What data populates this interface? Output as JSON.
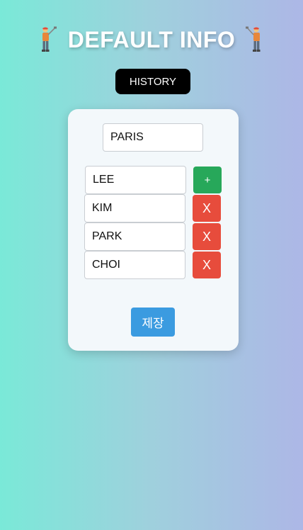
{
  "header": {
    "title": "DEFAULT INFO",
    "left_icon": "golfer-icon",
    "right_icon": "golfer-icon"
  },
  "history_button": {
    "label": "HISTORY"
  },
  "form": {
    "city": {
      "value": "PARIS"
    },
    "players": [
      {
        "value": "LEE",
        "action": "+"
      },
      {
        "value": "KIM",
        "action": "X"
      },
      {
        "value": "PARK",
        "action": "X"
      },
      {
        "value": "CHOI",
        "action": "X"
      }
    ],
    "save_label": "제장"
  },
  "colors": {
    "add": "#27a85a",
    "delete": "#e74c3c",
    "save": "#3b9be0",
    "history": "#000000"
  }
}
